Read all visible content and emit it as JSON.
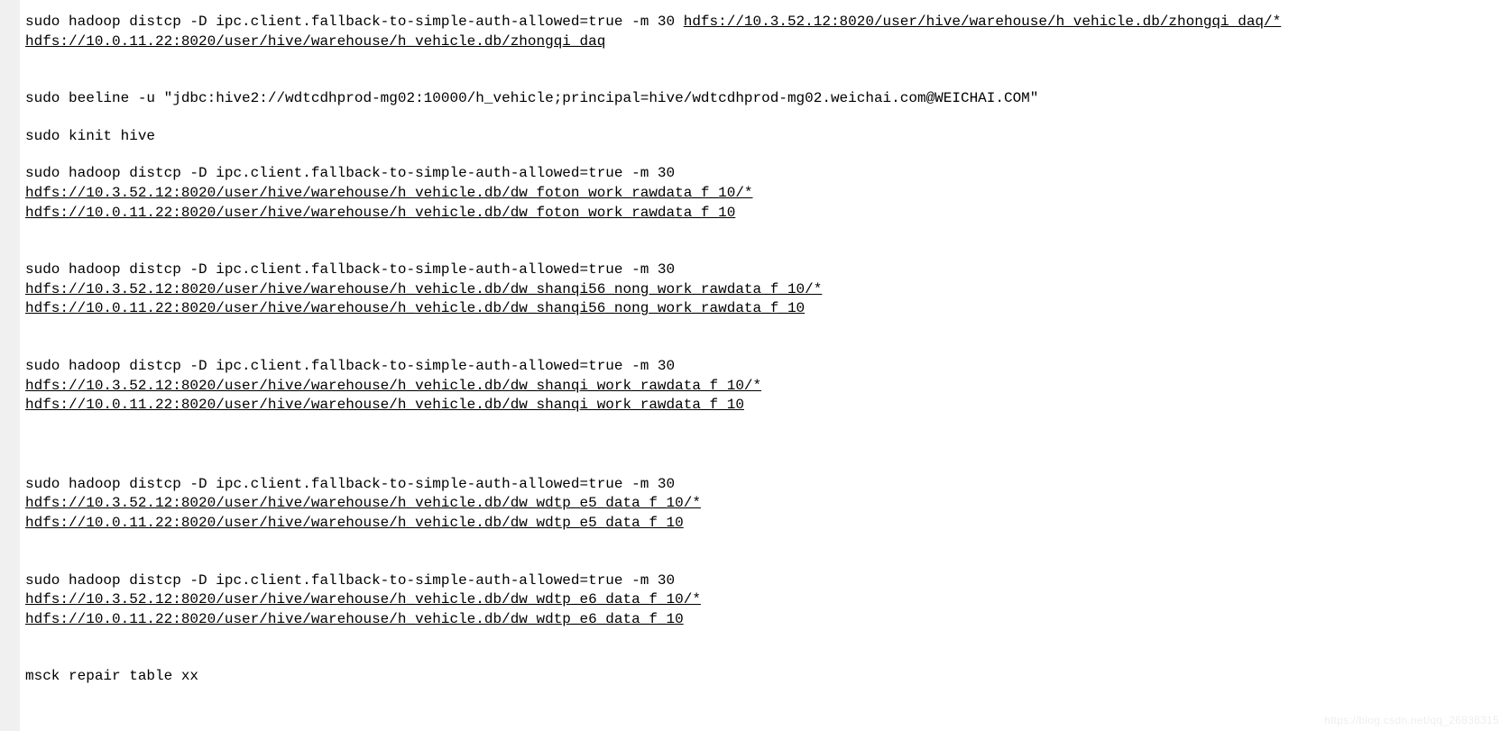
{
  "block1": {
    "prefix": "sudo hadoop distcp -D ipc.client.fallback-to-simple-auth-allowed=true -m 30 ",
    "link1": "hdfs://10.3.52.12:8020/user/hive/warehouse/h_vehicle.db/zhongqi_daq/*",
    "link2": "hdfs://10.0.11.22:8020/user/hive/warehouse/h_vehicle.db/zhongqi_daq"
  },
  "beeline": "sudo beeline -u \"jdbc:hive2://wdtcdhprod-mg02:10000/h_vehicle;principal=hive/wdtcdhprod-mg02.weichai.com@WEICHAI.COM\"",
  "kinit": "sudo kinit hive",
  "block2": {
    "prefix": "sudo hadoop distcp -D ipc.client.fallback-to-simple-auth-allowed=true -m 30",
    "link1": "hdfs://10.3.52.12:8020/user/hive/warehouse/h_vehicle.db/dw_foton_work_rawdata_f_10/*",
    "link2": "hdfs://10.0.11.22:8020/user/hive/warehouse/h_vehicle.db/dw_foton_work_rawdata_f_10"
  },
  "block3": {
    "prefix": "sudo hadoop distcp -D ipc.client.fallback-to-simple-auth-allowed=true -m 30",
    "link1": "hdfs://10.3.52.12:8020/user/hive/warehouse/h_vehicle.db/dw_shanqi56_nong_work_rawdata_f_10/*",
    "link2": "hdfs://10.0.11.22:8020/user/hive/warehouse/h_vehicle.db/dw_shanqi56_nong_work_rawdata_f_10"
  },
  "block4": {
    "prefix": "sudo hadoop distcp -D ipc.client.fallback-to-simple-auth-allowed=true -m 30",
    "link1": "hdfs://10.3.52.12:8020/user/hive/warehouse/h_vehicle.db/dw_shanqi_work_rawdata_f_10/*",
    "link2": "hdfs://10.0.11.22:8020/user/hive/warehouse/h_vehicle.db/dw_shanqi_work_rawdata_f_10"
  },
  "block5": {
    "prefix": "sudo hadoop distcp -D ipc.client.fallback-to-simple-auth-allowed=true -m 30",
    "link1": "hdfs://10.3.52.12:8020/user/hive/warehouse/h_vehicle.db/dw_wdtp_e5_data_f_10/*",
    "link2": "hdfs://10.0.11.22:8020/user/hive/warehouse/h_vehicle.db/dw_wdtp_e5_data_f_10"
  },
  "block6": {
    "prefix": "sudo hadoop distcp -D ipc.client.fallback-to-simple-auth-allowed=true -m 30",
    "link1": "hdfs://10.3.52.12:8020/user/hive/warehouse/h_vehicle.db/dw_wdtp_e6_data_f_10/*",
    "link2": "hdfs://10.0.11.22:8020/user/hive/warehouse/h_vehicle.db/dw_wdtp_e6_data_f_10"
  },
  "msck": "msck repair table xx",
  "watermark": "https://blog.csdn.net/qq_26838315"
}
